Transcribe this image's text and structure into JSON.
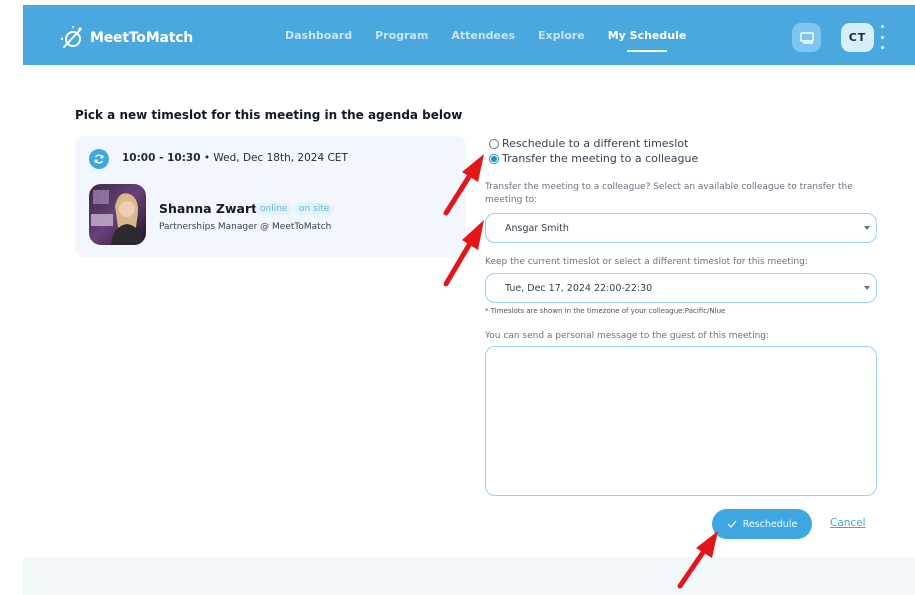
{
  "brand": {
    "name": "MeetToMatch"
  },
  "nav": {
    "items": [
      {
        "label": "Dashboard"
      },
      {
        "label": "Program"
      },
      {
        "label": "Attendees"
      },
      {
        "label": "Explore"
      },
      {
        "label": "My Schedule"
      }
    ],
    "active": "My Schedule"
  },
  "user": {
    "initials": "CT"
  },
  "page": {
    "heading": "Pick a new timeslot for this meeting in the agenda below"
  },
  "meeting": {
    "time": "10:00 - 10:30",
    "date": " • Wed, Dec 18th, 2024 CET",
    "person": {
      "name": "Shanna Zwart",
      "badges": [
        "online",
        "on site"
      ],
      "role": "Partnerships Manager @ MeetToMatch"
    }
  },
  "options": {
    "reschedule_label": "Reschedule to a different timeslot",
    "transfer_label": "Transfer the meeting to a colleague",
    "selected": "transfer"
  },
  "form": {
    "colleague_label": "Transfer the meeting to a colleague? Select an available colleague to transfer the meeting to:",
    "colleague_value": "Ansgar Smith",
    "timeslot_label": "Keep the current timeslot or select a different timeslot for this meeting:",
    "timeslot_value": "Tue, Dec 17, 2024 22:00-22:30",
    "timezone_note": "* Timeslots are shown in the timezone of your colleague:Pacific/Niue",
    "message_label": "You can send a personal message to the guest of this meeting:",
    "message_value": ""
  },
  "actions": {
    "reschedule_label": "Reschedule",
    "cancel_label": "Cancel"
  },
  "colors": {
    "header": "#4aa8df",
    "accent": "#3ea7e3",
    "annotation_arrow": "#e6151a"
  },
  "icons": {
    "logo": "meettomatch-logo-icon",
    "chat": "chat-icon",
    "menu": "kebab-menu-icon",
    "refresh": "refresh-icon",
    "check": "check-icon"
  }
}
